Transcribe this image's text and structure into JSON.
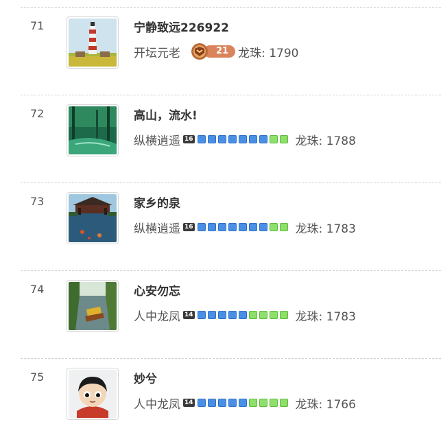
{
  "entries": [
    {
      "rank": "71",
      "name": "宁静致远226922",
      "title": "开坛元老",
      "level": "",
      "badge_level": "21",
      "bars": [],
      "dragon_pearls": "龙珠: 1790",
      "avatar": "lighthouse"
    },
    {
      "rank": "72",
      "name": "高山，流水!",
      "title": "纵横逍遥",
      "level": "16",
      "badge_level": "",
      "bars": [
        "blue",
        "blue",
        "blue",
        "blue",
        "blue",
        "blue",
        "blue",
        "green",
        "green"
      ],
      "dragon_pearls": "龙珠: 1788",
      "avatar": "forest-river"
    },
    {
      "rank": "73",
      "name": "家乡的泉",
      "title": "纵横逍遥",
      "level": "16",
      "badge_level": "",
      "bars": [
        "blue",
        "blue",
        "blue",
        "blue",
        "blue",
        "blue",
        "blue",
        "green",
        "green"
      ],
      "dragon_pearls": "龙珠: 1783",
      "avatar": "pavilion-lake"
    },
    {
      "rank": "74",
      "name": "心安勿忘",
      "title": "人中龙凤",
      "level": "14",
      "badge_level": "",
      "bars": [
        "blue",
        "blue",
        "blue",
        "blue",
        "blue",
        "green",
        "green",
        "green",
        "green"
      ],
      "dragon_pearls": "龙珠: 1783",
      "avatar": "canal-boat"
    },
    {
      "rank": "75",
      "name": "妙兮",
      "title": "人中龙凤",
      "level": "14",
      "badge_level": "",
      "bars": [
        "blue",
        "blue",
        "blue",
        "blue",
        "blue",
        "green",
        "green",
        "green",
        "green"
      ],
      "dragon_pearls": "龙珠: 1766",
      "avatar": "cartoon-girl"
    }
  ],
  "colors": {
    "bar_blue": "#4a8fe6",
    "bar_green": "#8ee06a",
    "badge": "#d9845a"
  }
}
